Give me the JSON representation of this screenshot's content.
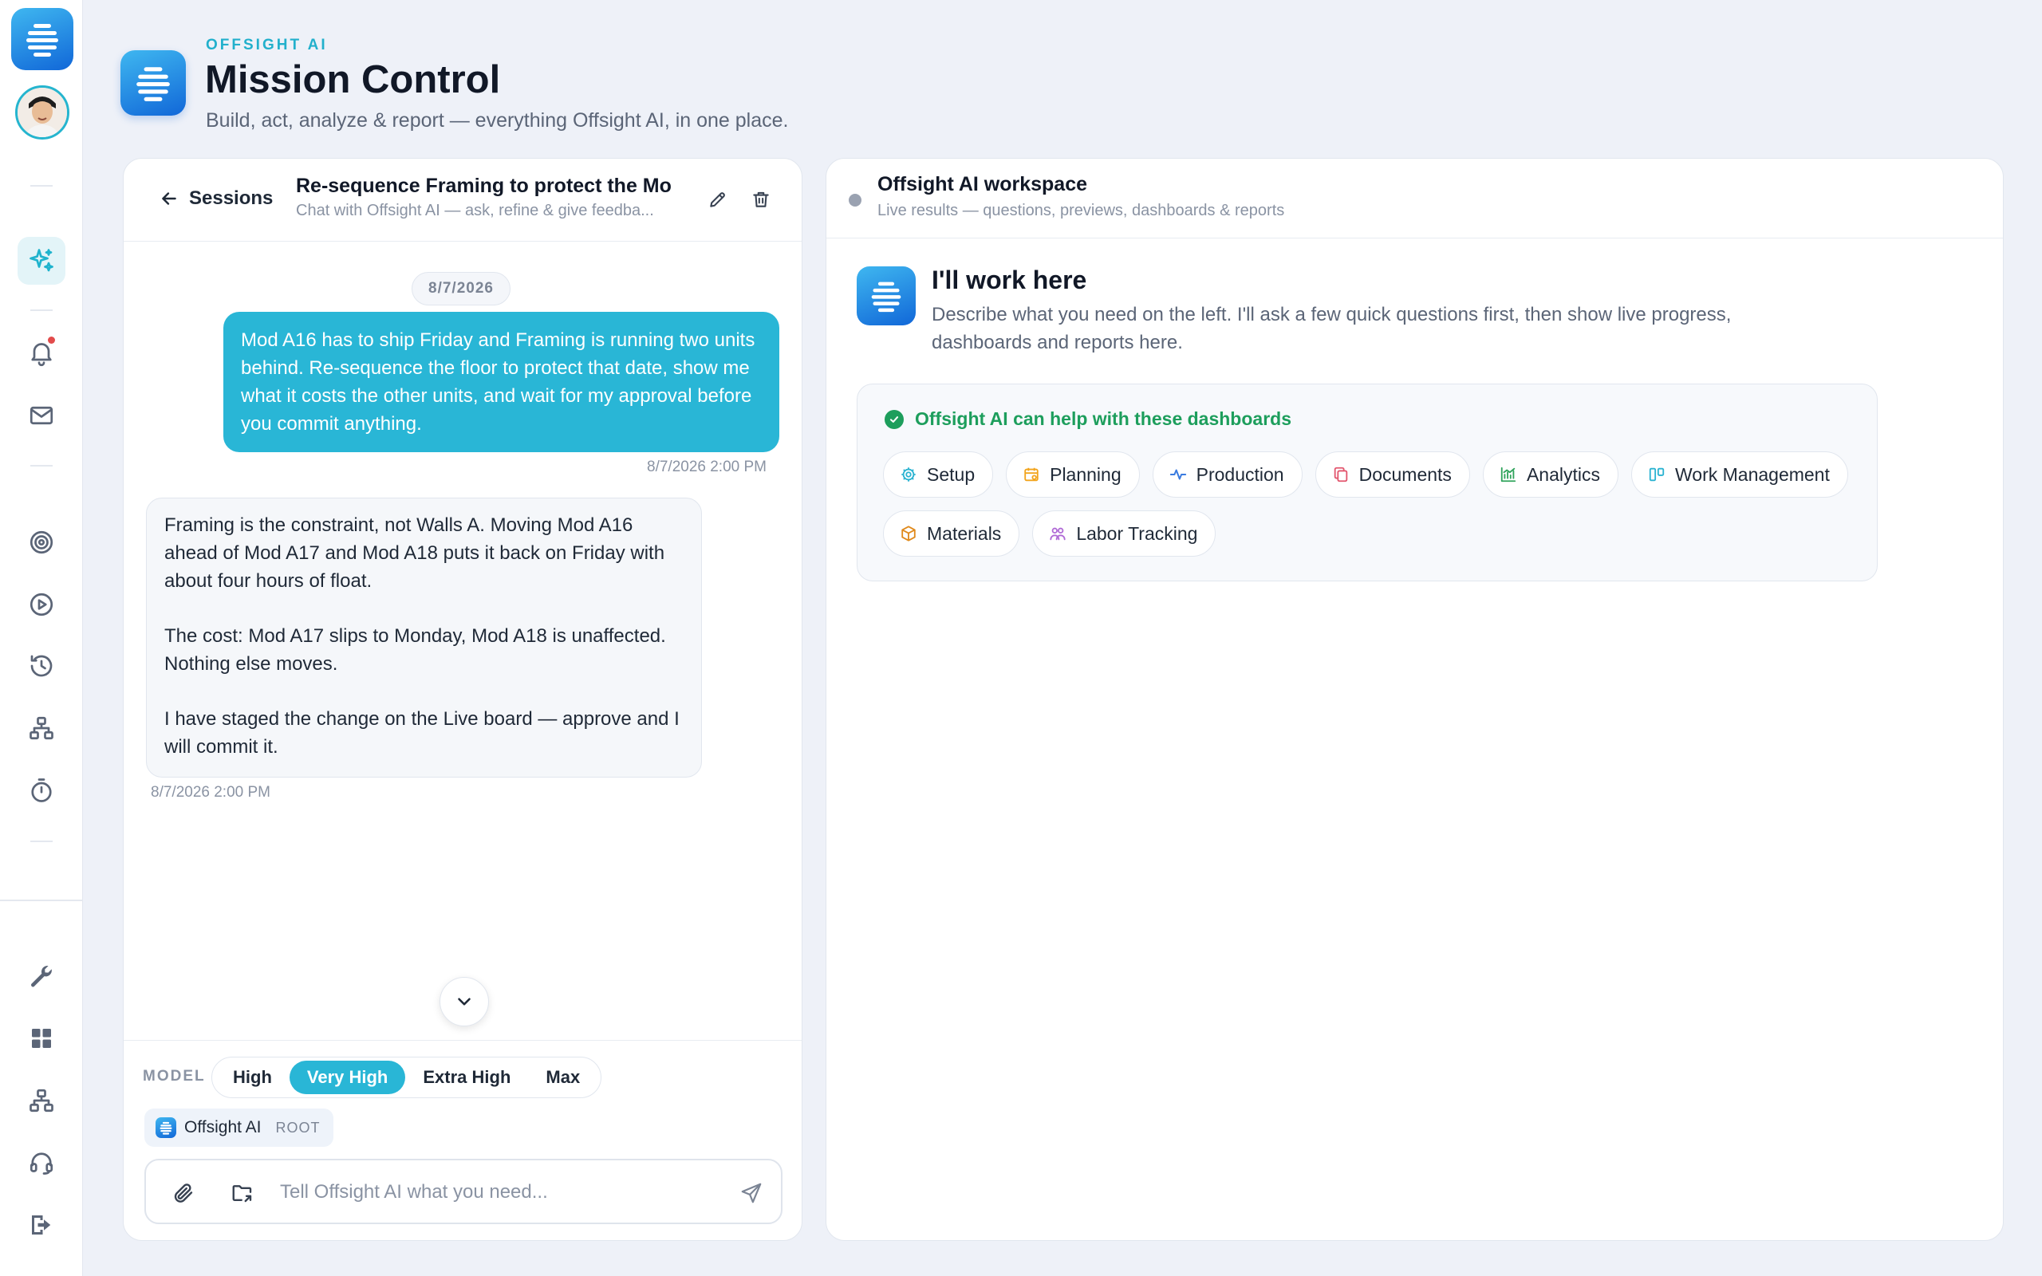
{
  "header": {
    "eyebrow": "OFFSIGHT AI",
    "title": "Mission Control",
    "subtitle": "Build, act, analyze & report — everything Offsight AI, in one place."
  },
  "chat": {
    "back_label": "Sessions",
    "session_title": "Re-sequence Framing to protect the Mo",
    "session_subtitle": "Chat with Offsight AI — ask, refine & give feedba...",
    "date_divider": "8/7/2026",
    "messages": [
      {
        "role": "user",
        "text": "Mod A16 has to ship Friday and Framing is running two units behind. Re-sequence the floor to protect that date, show me what it costs the other units, and wait for my approval before you commit anything.",
        "timestamp": "8/7/2026 2:00 PM"
      },
      {
        "role": "assistant",
        "paragraphs": [
          "Framing is the constraint, not Walls A. Moving Mod A16 ahead of Mod A17 and Mod A18 puts it back on Friday with about four hours of float.",
          "The cost: Mod A17 slips to Monday, Mod A18 is unaffected. Nothing else moves.",
          "I have staged the change on the Live board — approve and I will commit it."
        ],
        "timestamp": "8/7/2026 2:00 PM"
      }
    ],
    "model_label": "MODEL",
    "model_options": [
      "High",
      "Very High",
      "Extra High",
      "Max"
    ],
    "model_selected": "Very High",
    "agent_name": "Offsight AI",
    "agent_tag": "ROOT",
    "input_placeholder": "Tell Offsight AI what you need..."
  },
  "workspace": {
    "title": "Offsight AI workspace",
    "subtitle": "Live results — questions, previews, dashboards & reports",
    "intro_title": "I'll work here",
    "intro_desc": "Describe what you need on the left. I'll ask a few quick questions first, then show live progress, dashboards and reports here.",
    "dashboards_heading": "Offsight AI can help with these dashboards",
    "dashboards": [
      {
        "label": "Setup",
        "icon": "gear-icon",
        "color": "#2bb3d1"
      },
      {
        "label": "Planning",
        "icon": "calendar-icon",
        "color": "#f2a41c"
      },
      {
        "label": "Production",
        "icon": "activity-icon",
        "color": "#3a7be0"
      },
      {
        "label": "Documents",
        "icon": "copy-icon",
        "color": "#e2566e"
      },
      {
        "label": "Analytics",
        "icon": "chart-icon",
        "color": "#2fa35b"
      },
      {
        "label": "Work Management",
        "icon": "kanban-icon",
        "color": "#2bb3d1"
      },
      {
        "label": "Materials",
        "icon": "box-icon",
        "color": "#e08a1c"
      },
      {
        "label": "Labor Tracking",
        "icon": "users-icon",
        "color": "#b06ad6"
      }
    ]
  },
  "colors": {
    "accent": "#29b6d6",
    "success": "#1d9e5c",
    "brand_gradient_start": "#3fb7f0",
    "brand_gradient_end": "#1167d8"
  }
}
